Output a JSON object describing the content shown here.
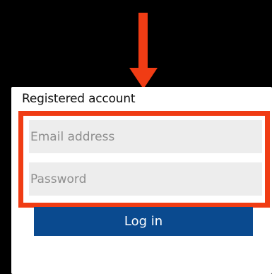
{
  "annotation": {
    "accent_color": "#f03c14",
    "arrow_icon": "arrow-down-icon"
  },
  "login_panel": {
    "title": "Registered account",
    "email_field": {
      "placeholder": "Email address",
      "value": ""
    },
    "password_field": {
      "placeholder": "Password",
      "value": ""
    },
    "login_button_label": "Log in",
    "button_color": "#0a4a8f"
  }
}
